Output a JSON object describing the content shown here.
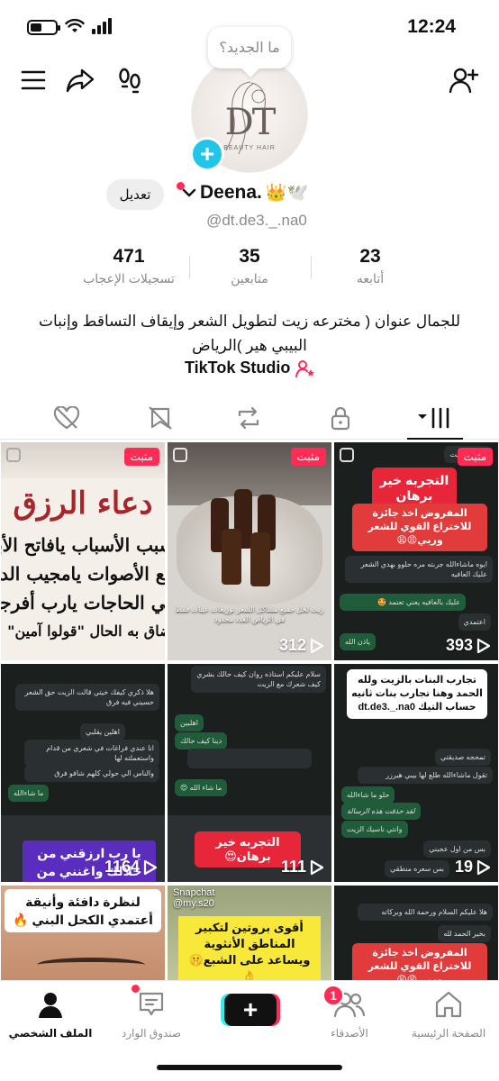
{
  "status_bar": {
    "time": "12:24"
  },
  "profile": {
    "bubble_text": "ما الجديد؟",
    "avatar_logo": "DT",
    "avatar_subtext": "BEAUTY HAIR",
    "display_name": "Deena.",
    "name_emojis": "👑🕊️",
    "edit_label": "تعديل",
    "username": "@dt.de3._.na0"
  },
  "stats": [
    {
      "value": "471",
      "label": "تسجيلات الإعجاب"
    },
    {
      "value": "35",
      "label": "متابعين"
    },
    {
      "value": "23",
      "label": "أتابعه"
    }
  ],
  "bio": "للجمال عنوان ( مخترعه زيت لتطويل الشعر وإيقاف التساقط وإنبات البيبي هير )الرياض",
  "studio_label": "TikTok Studio",
  "tabs": [
    "liked-icon",
    "favorites-icon",
    "reposts-icon",
    "private-icon",
    "videos-grid-icon"
  ],
  "videos": [
    {
      "pinned_label": "مثبت",
      "title": "دعاء الرزق",
      "lines": [
        "يامسبب الأسباب يافاتح الأبو",
        "سامع الأصوات يامجيب الدعوات",
        "قاضي الحاجات يارب أفرجها عن",
        "من ضاق به الحال \"قولوا آمين\""
      ]
    },
    {
      "pinned_label": "مثبت",
      "caption": "زيت لحل جميع مشاكل الشعر توزيعات عينات فقط في الرياض العدد محدود",
      "views": "312"
    },
    {
      "pinned_label": "مثبت",
      "tag_title": "التجربه خير برهان",
      "tag_sub": "المفروض اخذ جائزة للاختراع القوي للشعر وربي😩😩",
      "chat": [
        "ايوه ماشاءالله جربته مره حلوو بهدي الشعر عليك العافيه",
        "عليك بالعافيه يعني تعتمد 🤩",
        "اعتمدي",
        "ياذن الله"
      ],
      "views": "393"
    },
    {
      "overlay_text": "يا رب ارزقني من حلالك واغنني من رحمتك 👑😍",
      "chat": [
        "هلا ذكري كيفك خيتي قالت الزيت حق الشعر حسيني فيه فرق",
        "اهلين يقلبي",
        "انا عندي فراغات في شعري من قدام واستعملته لها",
        "والناس الي حولي كلهم شافو فرق",
        "ما شاءالله"
      ],
      "views": "1164"
    },
    {
      "tag_title": "التجربه خير برهان😍",
      "chat": [
        "سلام عليكم استاذه روان كيف حالك بشري كيف شعرك مع الزيت",
        "اهليين",
        "دينا كيف حالك",
        "ما شاء الله 😍"
      ],
      "views": "111"
    },
    {
      "white_text": "تجارب البنات بالزيت ولله الحمد وهنا تجارب بنات ثانيه حساب التيك dt.de3._.na0",
      "chat": [
        "تمحجه صديقتي",
        "تقول ماشاءالله طلع لها بيبي هيرزر",
        "حلو ما شاءالله",
        "لقد حذفت هذه الرسالة",
        "وانتي ناسيك الزيت",
        "بس من اول عجبني",
        "بس سعره منطقي"
      ],
      "views": "19"
    },
    {
      "white_text": "لنظرة دافئة وأنيقة أعتمدي الكحل البني 🔥"
    },
    {
      "snapchat_user": "Snapchat",
      "snapchat_handle": "@my.s20",
      "yellow_text": "أقوى بروتين لتكبير المناطق الأنثوية ويساعد على الشبع🤫👌"
    },
    {
      "chat": [
        "هلا عليكم السلام ورحمة الله وبركاته",
        "بخير الحمد لله"
      ],
      "tag_sub": "المفروض اخذ جائزة للاختراع القوي للشعر وربي😩😩"
    }
  ],
  "bottom_nav": [
    {
      "label": "الصفحة الرئيسية"
    },
    {
      "label": "الأصدقاء",
      "badge": "1"
    },
    {
      "label": ""
    },
    {
      "label": "صندوق الوارد"
    },
    {
      "label": "الملف الشخصي"
    }
  ],
  "colors": {
    "accent": "#fe2c55",
    "cyan": "#25f4ee",
    "plus_badge": "#20c5e8"
  }
}
